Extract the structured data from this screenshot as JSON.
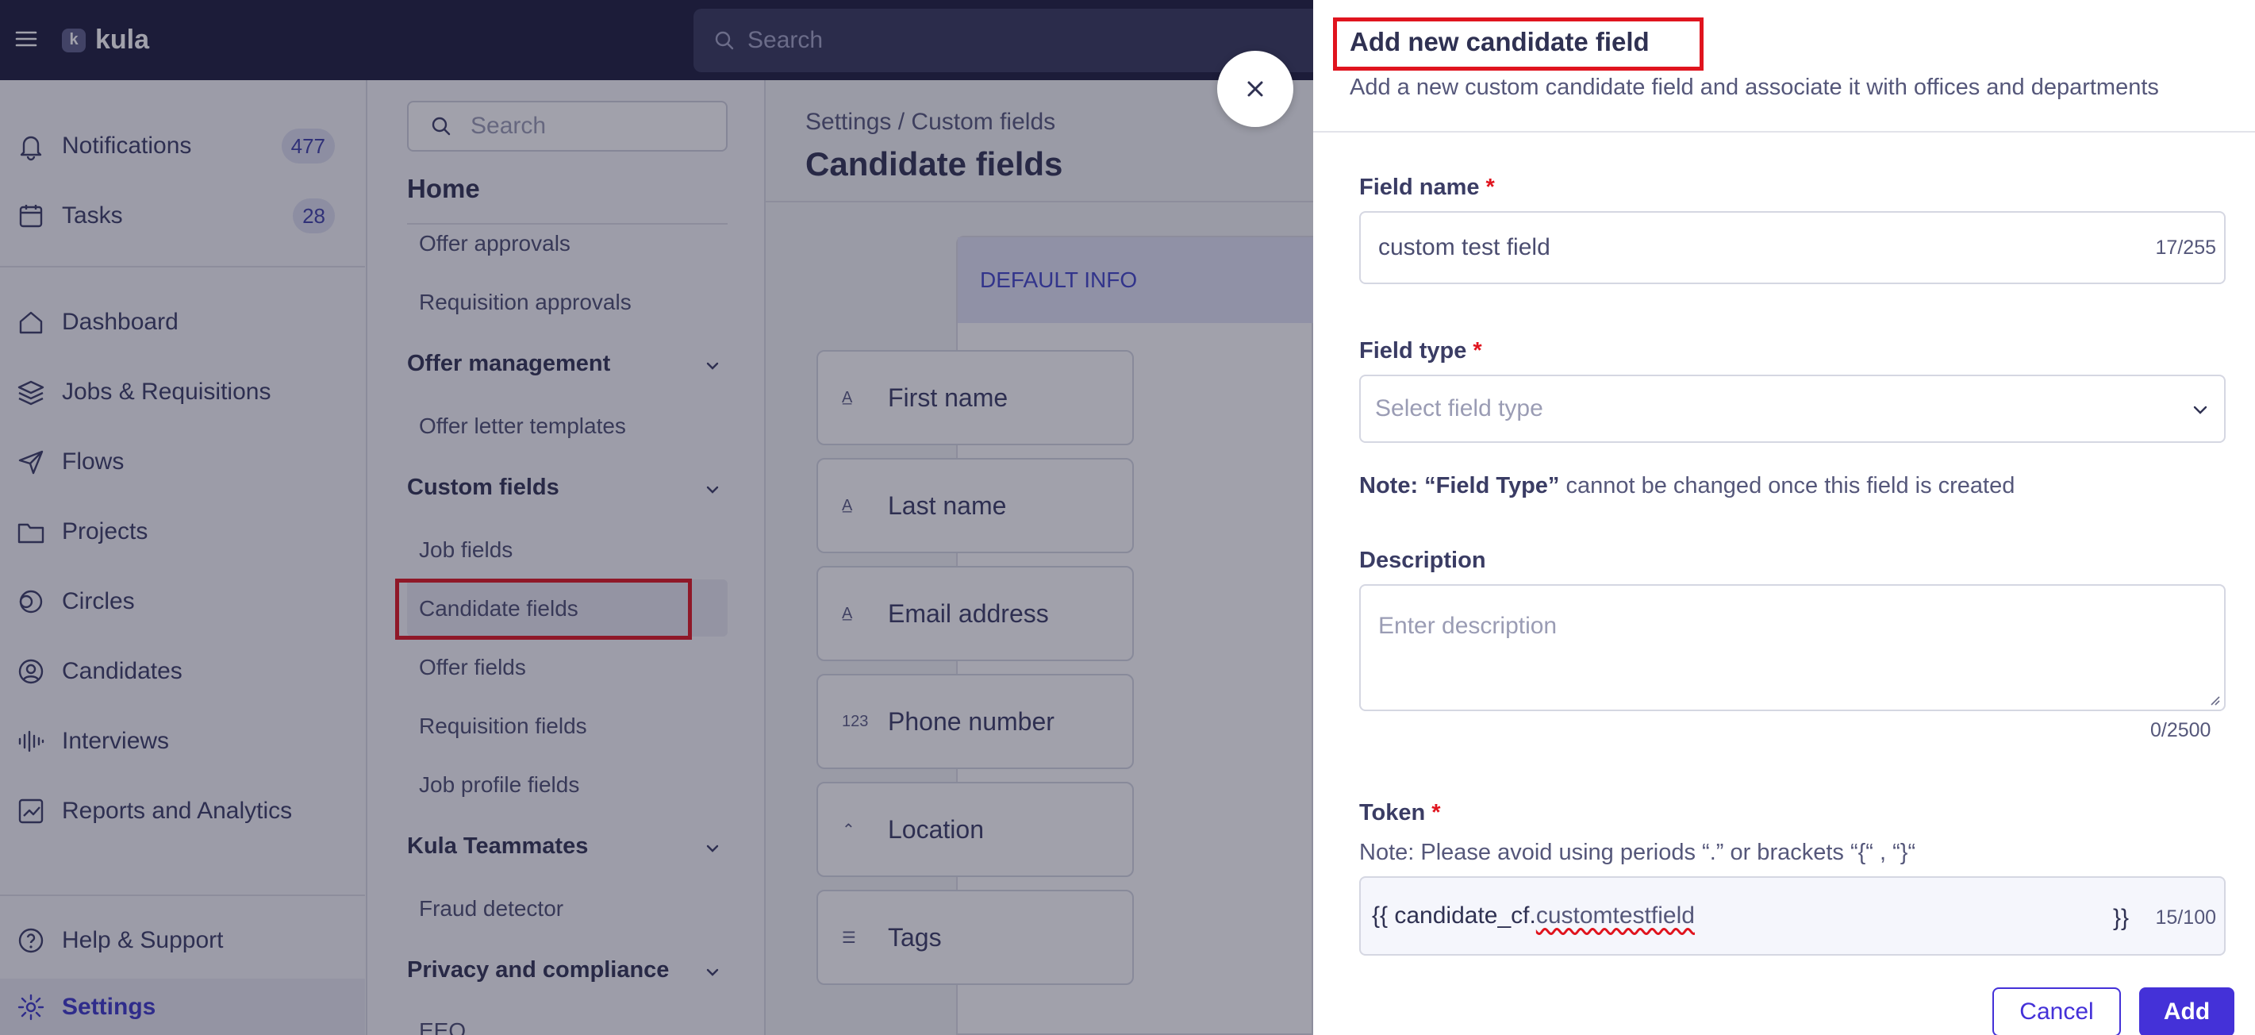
{
  "app": {
    "name": "kula",
    "logo_letter": "k"
  },
  "top_search": {
    "placeholder": "Search"
  },
  "nav": {
    "notifications": {
      "label": "Notifications",
      "count": "477"
    },
    "tasks": {
      "label": "Tasks",
      "count": "28"
    },
    "items": [
      {
        "label": "Dashboard",
        "icon": "home-icon"
      },
      {
        "label": "Jobs & Requisitions",
        "icon": "layers-icon"
      },
      {
        "label": "Flows",
        "icon": "send-icon"
      },
      {
        "label": "Projects",
        "icon": "folder-icon"
      },
      {
        "label": "Circles",
        "icon": "circles-icon"
      },
      {
        "label": "Candidates",
        "icon": "user-circle-icon"
      },
      {
        "label": "Interviews",
        "icon": "waveform-icon"
      },
      {
        "label": "Reports and Analytics",
        "icon": "chart-icon"
      }
    ],
    "help": "Help & Support",
    "settings": "Settings"
  },
  "settings_menu": {
    "search_placeholder": "Search",
    "home": "Home",
    "items": {
      "offer_approvals": "Offer approvals",
      "requisition_approvals": "Requisition approvals",
      "offer_management": "Offer management",
      "offer_letter_templates": "Offer letter templates",
      "custom_fields": "Custom fields",
      "job_fields": "Job fields",
      "candidate_fields": "Candidate fields",
      "offer_fields": "Offer fields",
      "requisition_fields": "Requisition fields",
      "job_profile_fields": "Job profile fields",
      "kula_teammates": "Kula Teammates",
      "fraud_detector": "Fraud detector",
      "privacy_compliance": "Privacy and compliance",
      "eeo": "EEO"
    }
  },
  "content": {
    "breadcrumb": "Settings / Custom fields",
    "title": "Candidate fields",
    "section_header": "DEFAULT INFO",
    "fields": [
      {
        "icon_text": "A̲",
        "label": "First name"
      },
      {
        "icon_text": "A̲",
        "label": "Last name"
      },
      {
        "icon_text": "A̲",
        "label": "Email address"
      },
      {
        "icon_text": "123",
        "label": "Phone number"
      },
      {
        "icon_text": "⌃",
        "label": "Location"
      },
      {
        "icon_text": "☰",
        "label": "Tags"
      }
    ]
  },
  "drawer": {
    "title": "Add new candidate field",
    "subtitle": "Add a new custom candidate field and associate it with offices and departments",
    "field_name": {
      "label": "Field name",
      "required": "*",
      "value": "custom test field",
      "counter": "17/255"
    },
    "field_type": {
      "label": "Field type",
      "required": "*",
      "placeholder": "Select field type"
    },
    "field_type_note": {
      "bold": "Note: “Field Type”",
      "rest": " cannot be changed once this field is created"
    },
    "description": {
      "label": "Description",
      "placeholder": "Enter description",
      "counter": "0/2500"
    },
    "token": {
      "label": "Token",
      "required": "*",
      "note": "Note: Please avoid using periods “.” or brackets “{“ , “}“",
      "prefix": "{{ candidate_cf.",
      "value": "customtestfield",
      "suffix": "}}",
      "counter": "15/100"
    },
    "cancel": "Cancel",
    "add": "Add"
  },
  "colors": {
    "brand": "#1a1b3c",
    "accent": "#4431d8",
    "highlight": "#e0141e"
  }
}
